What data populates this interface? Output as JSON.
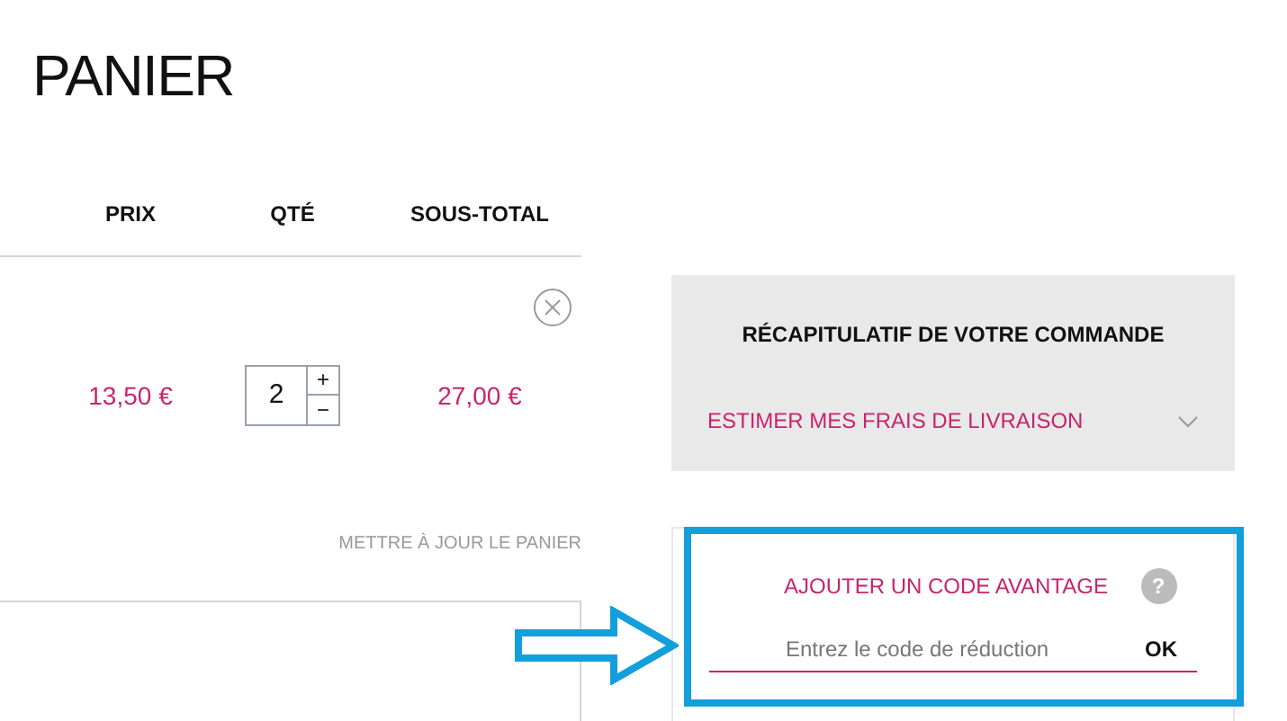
{
  "page_title": "PANIER",
  "cart": {
    "columns": [
      "PRIX",
      "QTÉ",
      "SOUS-TOTAL"
    ],
    "items": [
      {
        "price": "13,50 €",
        "quantity": "2",
        "increment": "+",
        "decrement": "−",
        "subtotal": "27,00 €"
      }
    ],
    "update_link": "METTRE À JOUR LE PANIER"
  },
  "summary": {
    "title": "RÉCAPITULATIF DE VOTRE COMMANDE",
    "shipping": {
      "label": "ESTIMER MES FRAIS DE LIVRAISON",
      "expanded": false
    }
  },
  "coupon": {
    "title": "AJOUTER UN CODE AVANTAGE",
    "help": "?",
    "placeholder": "Entrez le code de réduction",
    "button": "OK"
  }
}
